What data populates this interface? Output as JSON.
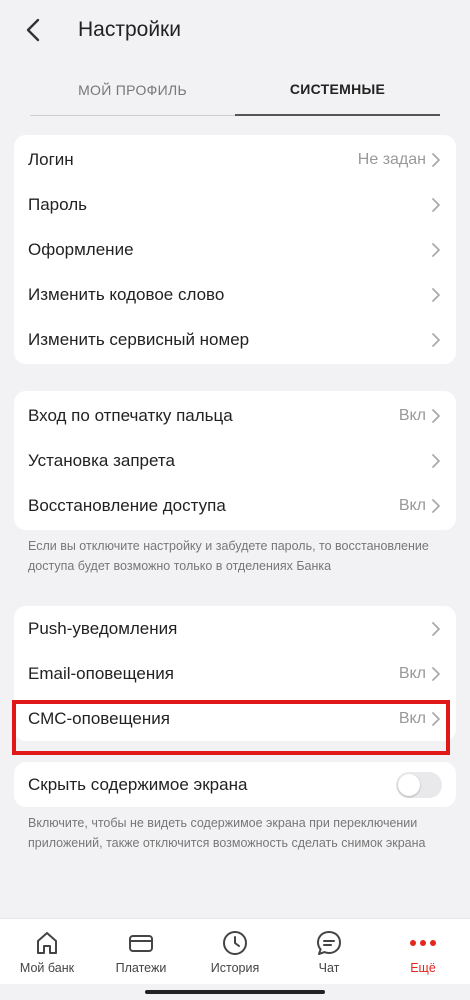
{
  "header": {
    "title": "Настройки"
  },
  "tabs": [
    {
      "label": "МОЙ ПРОФИЛЬ",
      "active": false
    },
    {
      "label": "СИСТЕМНЫЕ",
      "active": true
    }
  ],
  "group1": [
    {
      "label": "Логин",
      "value": "Не задан"
    },
    {
      "label": "Пароль",
      "value": ""
    },
    {
      "label": "Оформление",
      "value": ""
    },
    {
      "label": "Изменить кодовое слово",
      "value": ""
    },
    {
      "label": "Изменить сервисный номер",
      "value": ""
    }
  ],
  "group2": [
    {
      "label": "Вход по отпечатку пальца",
      "value": "Вкл"
    },
    {
      "label": "Установка запрета",
      "value": ""
    },
    {
      "label": "Восстановление доступа",
      "value": "Вкл"
    }
  ],
  "group2_note": "Если вы отключите настройку и забудете пароль, то восстановление доступа будет возможно только в отделениях Банка",
  "group3": [
    {
      "label": "Push-уведомления",
      "value": ""
    },
    {
      "label": "Email-оповещения",
      "value": "Вкл"
    },
    {
      "label": "СМС-оповещения",
      "value": "Вкл"
    }
  ],
  "group4": {
    "label": "Скрыть содержимое экрана",
    "toggle_on": false,
    "note": "Включите, чтобы не видеть содержимое экрана при переключении приложений, также отключится возможность сделать снимок экрана"
  },
  "bottom_nav": [
    {
      "label": "Мой банк",
      "icon": "home-icon",
      "active": false
    },
    {
      "label": "Платежи",
      "icon": "wallet-icon",
      "active": false
    },
    {
      "label": "История",
      "icon": "clock-icon",
      "active": false
    },
    {
      "label": "Чат",
      "icon": "chat-icon",
      "active": false
    },
    {
      "label": "Ещё",
      "icon": "more-dots-icon",
      "active": true
    }
  ],
  "colors": {
    "accent": "#e4261d",
    "highlight": "#e01818",
    "background": "#f2f2f4"
  }
}
